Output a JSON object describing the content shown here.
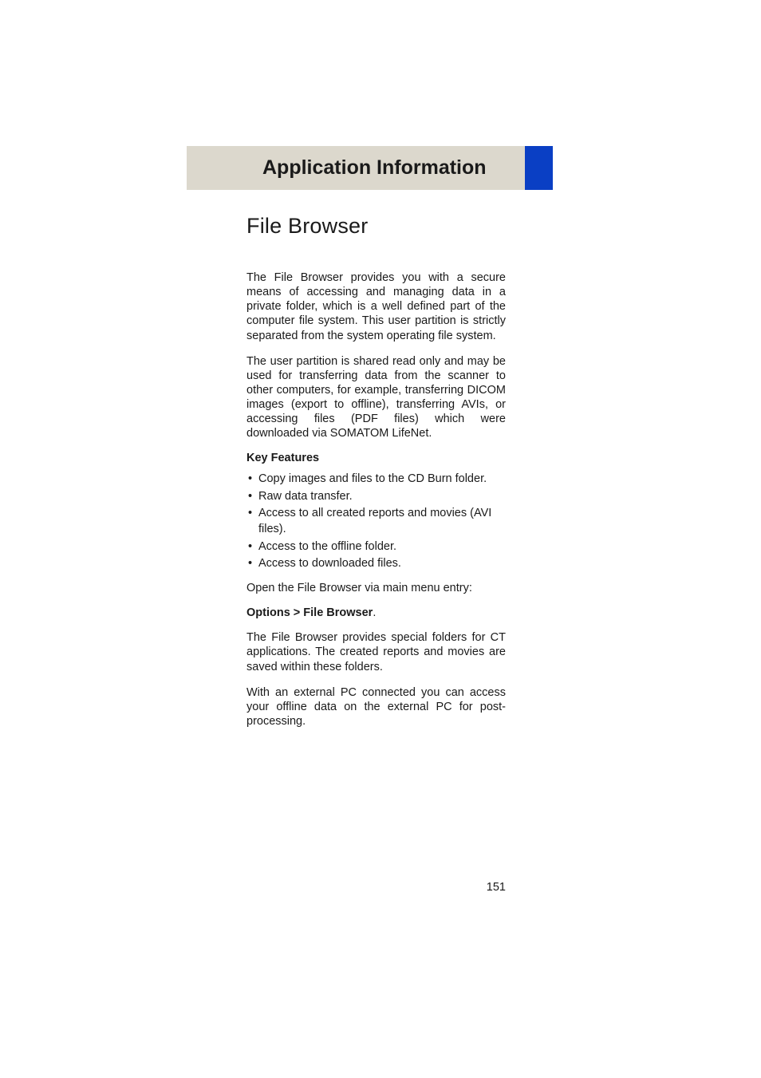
{
  "header": {
    "title": "Application Information"
  },
  "content": {
    "section_heading": "File Browser",
    "para1": "The File Browser provides you with a secure means of accessing and managing data in a private folder, which is a well defined part of the computer file system. This user partition is strictly separated from the system operating file system.",
    "para2": "The user partition is shared read only and may be used for transferring data from the scanner to other computers, for example, transferring DICOM images (export to offline), transferring AVIs, or accessing files (PDF files) which were downloaded via SOMATOM LifeNet.",
    "key_features_label": "Key Features",
    "features": [
      "Copy images and files to the CD Burn folder.",
      "Raw data transfer.",
      "Access to all created reports and movies (AVI files).",
      "Access to the offline folder.",
      "Access to downloaded files."
    ],
    "open_via": "Open the File Browser via main menu entry:",
    "nav_path_bold": "Options > File Browser",
    "nav_path_suffix": ".",
    "para3": "The File Browser provides special folders for CT applications. The created reports and movies are saved within these folders.",
    "para4": "With an external PC connected you can access your offline data on the external PC for post-processing."
  },
  "page_number": "151"
}
